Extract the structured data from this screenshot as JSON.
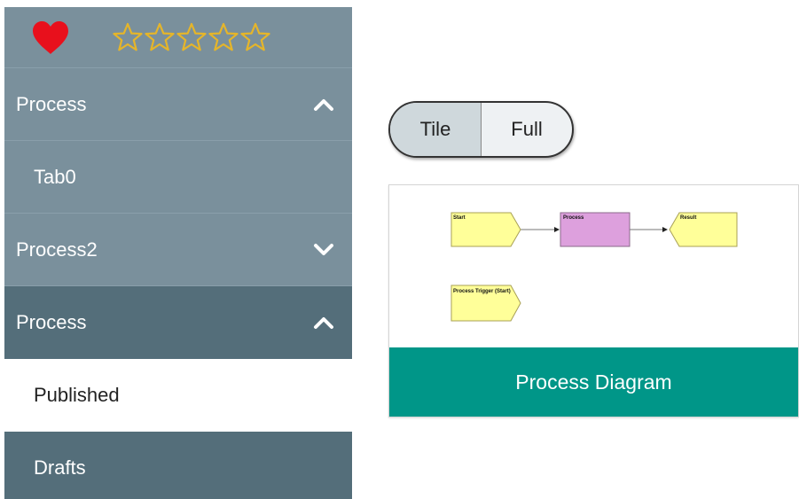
{
  "colors": {
    "sidebar_bg": "#7a909c",
    "sidebar_active_bg": "#546e7a",
    "heart": "#e8101c",
    "star_outline": "#e5b52a",
    "card_footer_bg": "#009688",
    "toggle_active_bg": "#cfd8dc",
    "diagram_event": "#ffff99",
    "diagram_process": "#dda0dd"
  },
  "rating": {
    "favorite_icon": "heart-icon",
    "star_icon": "star-outline-icon",
    "stars_total": 5,
    "stars_filled": 0
  },
  "sidebar": {
    "items": [
      {
        "label": "Process",
        "icon": "chevron-up-icon",
        "expanded": true
      },
      {
        "label": "Tab0"
      },
      {
        "label": "Process2",
        "icon": "chevron-down-icon",
        "expanded": false
      },
      {
        "label": "Process",
        "icon": "chevron-up-icon",
        "expanded": true
      },
      {
        "label": "Published",
        "selected": true
      },
      {
        "label": "Drafts"
      }
    ]
  },
  "view_toggle": {
    "options": [
      "Tile",
      "Full"
    ],
    "selected": "Tile"
  },
  "card": {
    "title": "Process Diagram",
    "diagram": {
      "nodes": [
        {
          "id": "start",
          "label": "Start",
          "kind": "event"
        },
        {
          "id": "process",
          "label": "Process",
          "kind": "process"
        },
        {
          "id": "result",
          "label": "Result",
          "kind": "event"
        },
        {
          "id": "trigger",
          "label": "Process Trigger (Start)",
          "kind": "event"
        }
      ],
      "edges": [
        {
          "from": "start",
          "to": "process"
        },
        {
          "from": "process",
          "to": "result"
        }
      ]
    }
  }
}
